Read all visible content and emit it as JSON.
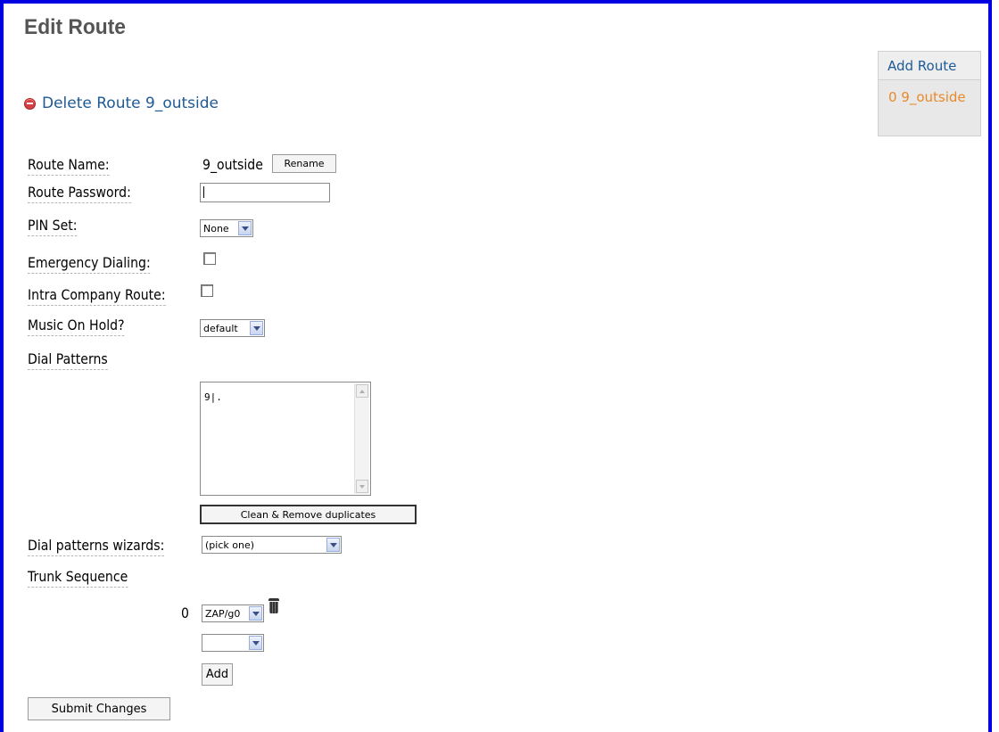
{
  "header": {
    "title": "Edit Route"
  },
  "delete_link": {
    "label": "Delete Route 9_outside"
  },
  "sidebar": {
    "add_label": "Add Route",
    "routes": [
      {
        "label": "0 9_outside",
        "color": "#e8892b"
      }
    ]
  },
  "form": {
    "route_name": {
      "label": "Route Name:",
      "value": "9_outside",
      "rename_button": "Rename"
    },
    "route_password": {
      "label": "Route Password:",
      "value": ""
    },
    "pin_set": {
      "label": "PIN Set:",
      "selected": "None"
    },
    "emergency_dialing": {
      "label": "Emergency Dialing:",
      "checked": false
    },
    "intra_company_route": {
      "label": "Intra Company Route:",
      "checked": false
    },
    "music_on_hold": {
      "label": "Music On Hold?",
      "selected": "default"
    },
    "dial_patterns": {
      "label": "Dial Patterns",
      "value": "9|.",
      "clean_button": "Clean & Remove duplicates"
    },
    "dial_patterns_wizards": {
      "label": "Dial patterns wizards:",
      "selected": "(pick one)"
    },
    "trunk_sequence": {
      "label": "Trunk Sequence",
      "entries": [
        {
          "index": "0",
          "trunk": "ZAP/g0"
        }
      ],
      "new_trunk": "",
      "add_button": "Add"
    },
    "submit_button": "Submit Changes"
  },
  "colors": {
    "frame_border": "#0000e0",
    "link": "#1e5a96",
    "delete_icon": "#d34242"
  }
}
